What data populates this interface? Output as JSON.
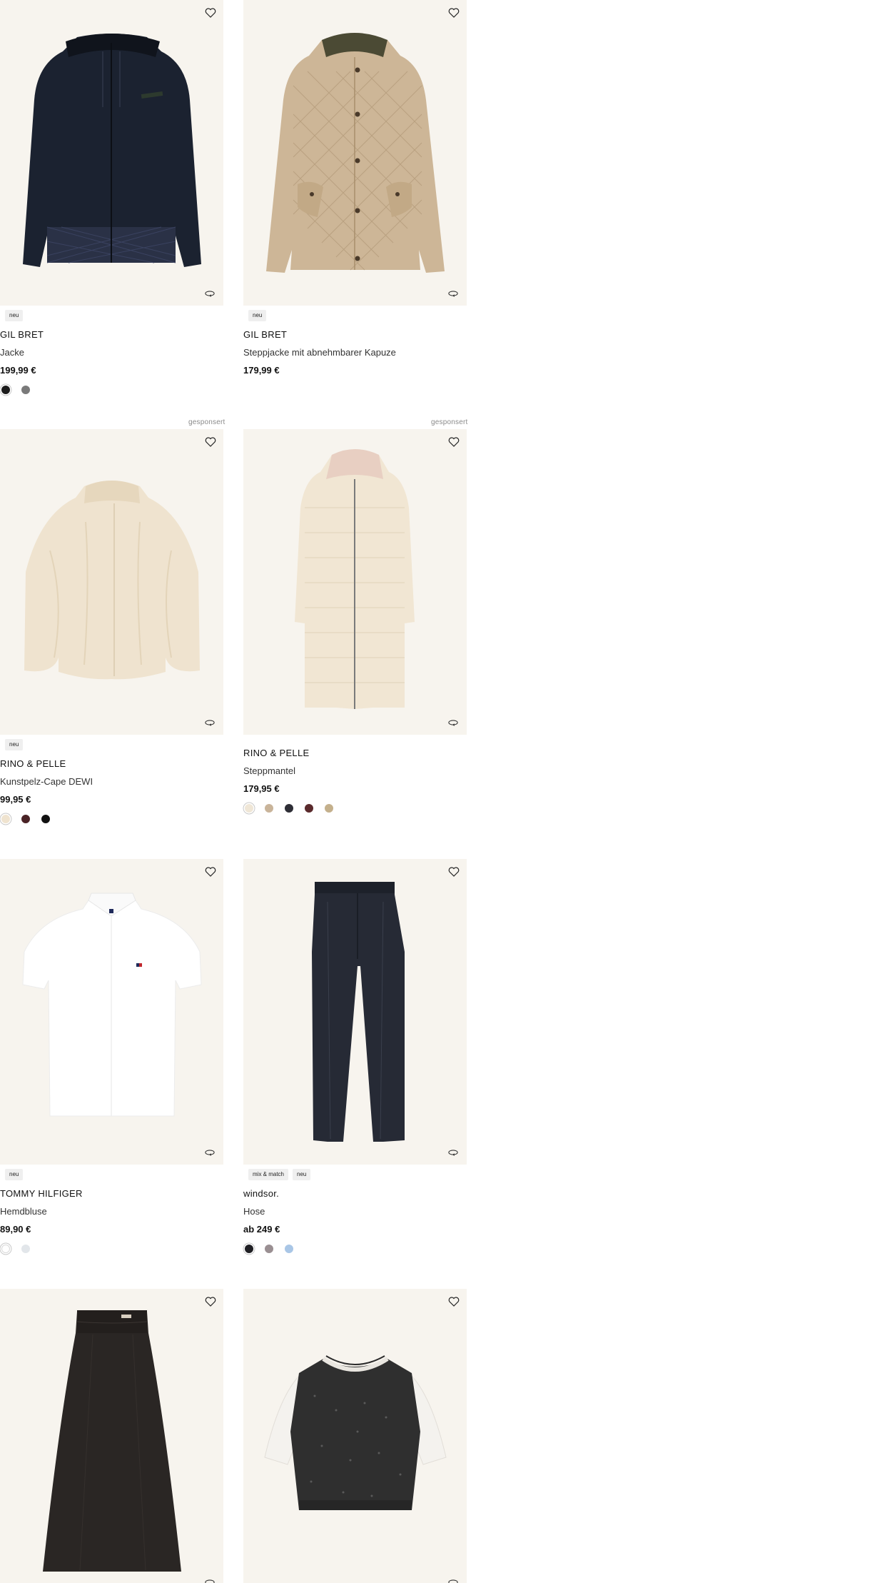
{
  "products": [
    {
      "sponsored": "",
      "badges": [
        "neu"
      ],
      "brand": "GIL BRET",
      "name": "Jacke",
      "price": "199,99 €",
      "swatches": [
        "#1c1c1c",
        "#7a7a7a"
      ],
      "image_icon": "dark-hooded-jacket-image",
      "wishlist_icon": "heart-icon",
      "viewer_icon": "360-view-icon"
    },
    {
      "sponsored": "",
      "badges": [
        "neu"
      ],
      "brand": "GIL BRET",
      "name": "Steppjacke mit abnehmbarer Kapuze",
      "price": "179,99 €",
      "swatches": [],
      "image_icon": "beige-quilted-jacket-image",
      "wishlist_icon": "heart-icon",
      "viewer_icon": "360-view-icon"
    },
    {
      "sponsored": "gesponsert",
      "badges": [
        "neu"
      ],
      "brand": "RINO & PELLE",
      "name": "Kunstpelz-Cape DEWI",
      "price": "99,95 €",
      "swatches": [
        "#efe3cf",
        "#4a2326",
        "#111111"
      ],
      "image_icon": "faux-fur-cape-image",
      "wishlist_icon": "heart-icon",
      "viewer_icon": "360-view-icon"
    },
    {
      "sponsored": "gesponsert",
      "badges": [],
      "brand": "RINO & PELLE",
      "name": "Steppmantel",
      "price": "179,95 €",
      "swatches": [
        "#efe6d6",
        "#c9b49a",
        "#2e2e36",
        "#5a2a2c",
        "#c4b08c"
      ],
      "image_icon": "long-quilted-coat-image",
      "wishlist_icon": "heart-icon",
      "viewer_icon": "360-view-icon"
    },
    {
      "sponsored": "",
      "badges": [
        "neu"
      ],
      "brand": "TOMMY HILFIGER",
      "name": "Hemdbluse",
      "price": "89,90 €",
      "swatches": [
        "#ffffff",
        "#e2e6ea"
      ],
      "image_icon": "white-shirt-blouse-image",
      "wishlist_icon": "heart-icon",
      "viewer_icon": "360-view-icon"
    },
    {
      "sponsored": "",
      "badges": [
        "mix & match",
        "neu"
      ],
      "brand": "windsor.",
      "name": "Hose",
      "price": "ab 249 €",
      "swatches": [
        "#1f1f24",
        "#9a8f92",
        "#a9c6e6"
      ],
      "image_icon": "navy-trousers-image",
      "wishlist_icon": "heart-icon",
      "viewer_icon": "360-view-icon"
    },
    {
      "sponsored": "",
      "badges": [],
      "brand": "",
      "name": "",
      "price": "",
      "swatches": [],
      "image_icon": "black-midi-skirt-image",
      "wishlist_icon": "heart-icon",
      "viewer_icon": "360-view-icon"
    },
    {
      "sponsored": "",
      "badges": [],
      "brand": "",
      "name": "",
      "price": "",
      "swatches": [],
      "image_icon": "sequin-vest-top-image",
      "wishlist_icon": "heart-icon",
      "viewer_icon": "360-view-icon"
    }
  ],
  "colors": {
    "image_background": "#f7f4ee",
    "badge_background": "#efefef",
    "text": "#1a1a1a",
    "sponsored_text": "#8a8a8a"
  }
}
